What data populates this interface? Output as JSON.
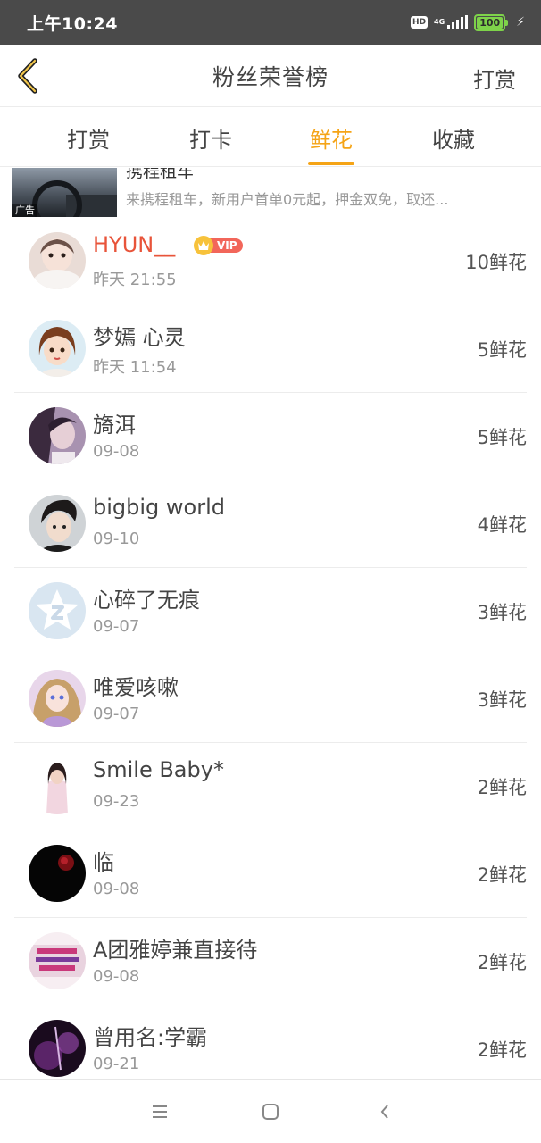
{
  "status_bar": {
    "time": "上午10:24",
    "hd": "HD",
    "network": "4G",
    "battery": "100"
  },
  "header": {
    "title": "粉丝荣誉榜",
    "action": "打赏"
  },
  "tabs": [
    {
      "label": "打赏",
      "active": false
    },
    {
      "label": "打卡",
      "active": false
    },
    {
      "label": "鲜花",
      "active": true
    },
    {
      "label": "收藏",
      "active": false
    }
  ],
  "ad": {
    "title": "携程租车",
    "description": "来携程租车，新用户首单0元起，押金双免，取还...",
    "badge": "广告"
  },
  "ranking": [
    {
      "name": "HYUN__",
      "date": "昨天 21:55",
      "count": "10鲜花",
      "vip": true,
      "vip_label": "VIP"
    },
    {
      "name": "梦嫣 心灵",
      "date": "昨天 11:54",
      "count": "5鲜花"
    },
    {
      "name": "旖洱",
      "date": "09-08",
      "count": "5鲜花"
    },
    {
      "name": "bigbig world",
      "date": "09-10",
      "count": "4鲜花"
    },
    {
      "name": "心碎了无痕",
      "date": "09-07",
      "count": "3鲜花"
    },
    {
      "name": "唯爱咳嗽",
      "date": "09-07",
      "count": "3鲜花"
    },
    {
      "name": "Smile Baby*",
      "date": "09-23",
      "count": "2鲜花"
    },
    {
      "name": "临",
      "date": "09-08",
      "count": "2鲜花"
    },
    {
      "name": "A团雅婷兼直接待",
      "date": "09-08",
      "count": "2鲜花"
    },
    {
      "name": "曾用名:学霸",
      "date": "09-21",
      "count": "2鲜花"
    }
  ],
  "colors": {
    "accent": "#f5a416",
    "vip_name": "#e8543a",
    "status_bar": "#4a4a4a"
  }
}
